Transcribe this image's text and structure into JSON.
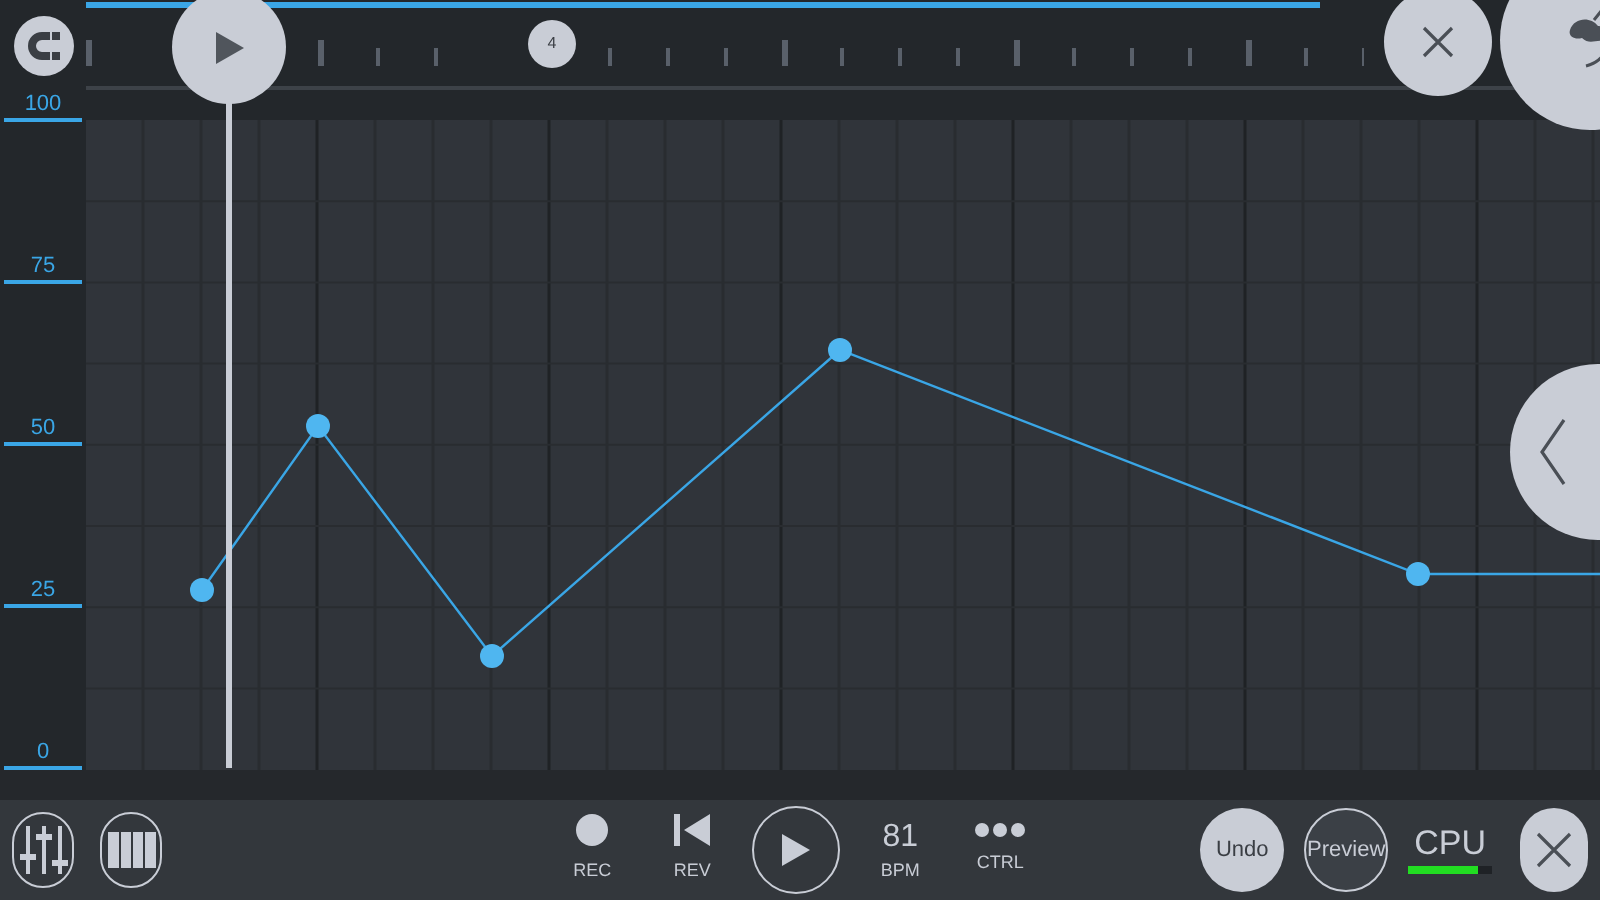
{
  "timeline": {
    "marker": "4"
  },
  "scale_labels": [
    "100",
    "75",
    "50",
    "25",
    "0"
  ],
  "transport": [
    {
      "kind": "rec",
      "label": "REC"
    },
    {
      "kind": "rev",
      "label": "REV"
    },
    {
      "kind": "play"
    },
    {
      "kind": "bpm",
      "value": "81",
      "label": "BPM"
    },
    {
      "kind": "ctrl",
      "label": "CTRL"
    }
  ],
  "actions": [
    {
      "label": "Undo",
      "kind": "filled"
    },
    {
      "label": "Preview",
      "kind": "outline"
    }
  ],
  "cpu": {
    "label": "CPU",
    "level": 0.83
  }
}
